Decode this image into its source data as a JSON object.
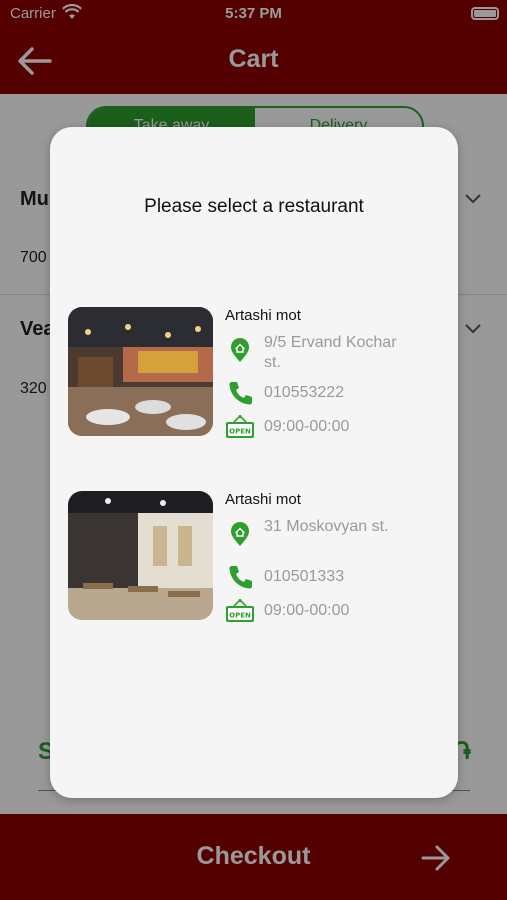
{
  "status_bar": {
    "carrier": "Carrier",
    "time": "5:37 PM"
  },
  "nav": {
    "title": "Cart"
  },
  "segment": {
    "take_away": "Take away",
    "delivery": "Delivery"
  },
  "cart_items": [
    {
      "name": "Mu",
      "price": "700"
    },
    {
      "name": "Vea",
      "price": "320"
    }
  ],
  "summary": {
    "label": "S",
    "currency": "֏"
  },
  "checkout": {
    "label": "Checkout"
  },
  "modal": {
    "title": "Please select a restaurant",
    "restaurants": [
      {
        "name": "Artashi mot",
        "address": "9/5 Ervand Kochar st.",
        "phone": "010553222",
        "hours": "09:00-00:00"
      },
      {
        "name": "Artashi mot",
        "address": "31 Moskovyan st.",
        "phone": "010501333",
        "hours": "09:00-00:00"
      }
    ]
  },
  "icons": {
    "location": "location-pin-icon",
    "phone": "phone-icon",
    "open": "open-sign-icon"
  },
  "colors": {
    "brand_red": "#8c0000",
    "accent_green": "#2e9e2e",
    "modal_bg": "#f5f5f5",
    "secondary_text": "#9a9a9a"
  }
}
